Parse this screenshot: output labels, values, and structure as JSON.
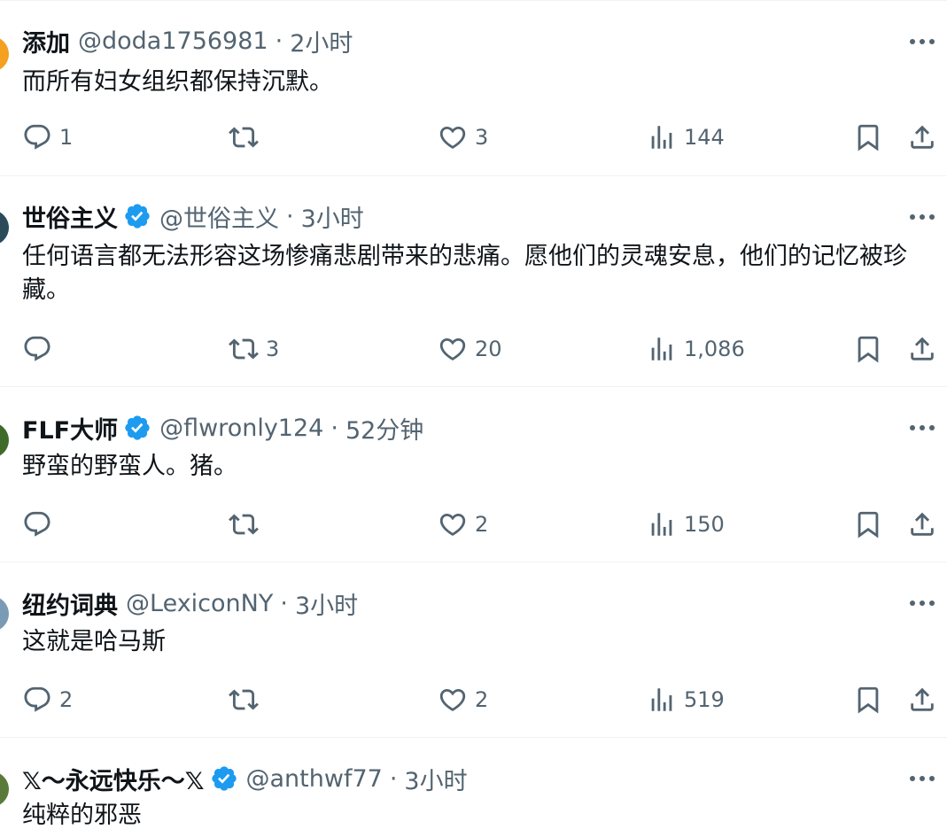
{
  "tweets": [
    {
      "name": "添加",
      "verified": false,
      "handle": "@doda1756981",
      "separator": "·",
      "time": "2小时",
      "text": "而所有妇女组织都保持沉默。",
      "avatar_color": "#f4a020",
      "replies": "1",
      "retweets": "",
      "likes": "3",
      "views": "144"
    },
    {
      "name": "世俗主义",
      "verified": true,
      "handle": "@世俗主义",
      "separator": "·",
      "time": "3小时",
      "text": "任何语言都无法形容这场惨痛悲剧带来的悲痛。愿他们的灵魂安息，他们的记忆被珍藏。",
      "avatar_color": "#2b4a5a",
      "replies": "",
      "retweets": "3",
      "likes": "20",
      "views": "1,086"
    },
    {
      "name": "FLF大师",
      "verified": true,
      "handle": "@flwronly124",
      "separator": "·",
      "time": "52分钟",
      "text": "野蛮的野蛮人。猪。",
      "avatar_color": "#3f6b2a",
      "replies": "",
      "retweets": "",
      "likes": "2",
      "views": "150"
    },
    {
      "name": "纽约词典",
      "verified": false,
      "handle": "@LexiconNY",
      "separator": "·",
      "time": "3小时",
      "text": "这就是哈马斯",
      "avatar_color": "#7a9ab5",
      "replies": "2",
      "retweets": "",
      "likes": "2",
      "views": "519"
    },
    {
      "name": "𝕏〜永远快乐〜𝕏",
      "verified": true,
      "handle": "@anthwf77",
      "separator": "·",
      "time": "3小时",
      "text": "纯粹的邪恶",
      "avatar_color": "#5a7a3a",
      "replies": "",
      "retweets": "",
      "likes": "",
      "views": ""
    }
  ],
  "colors": {
    "text_primary": "#0f1419",
    "text_secondary": "#536471",
    "verified_blue": "#1d9bf0",
    "divider": "#eff3f4"
  },
  "icons": [
    "reply-icon",
    "retweet-icon",
    "like-icon",
    "views-icon",
    "bookmark-icon",
    "share-icon",
    "more-icon",
    "verified-badge-icon"
  ]
}
